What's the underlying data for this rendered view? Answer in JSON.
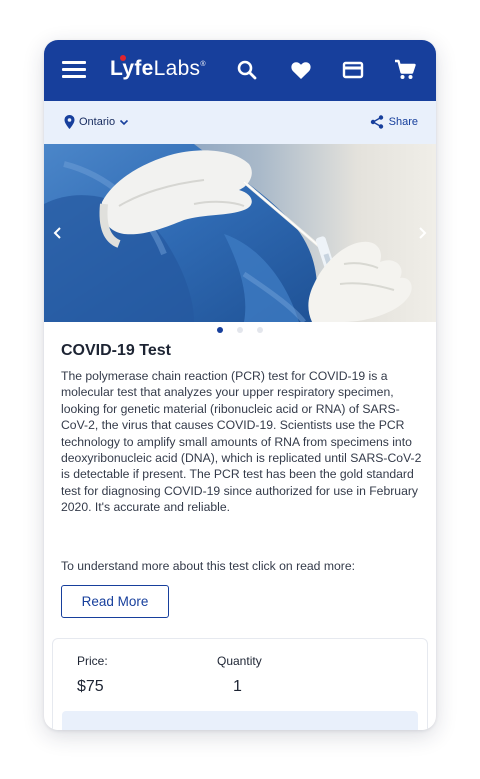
{
  "header": {
    "logo_main": "Lyfe",
    "logo_sub": "Labs",
    "logo_mark": "®",
    "menu_icon": "hamburger-menu-icon",
    "search_icon": "search-icon",
    "favorites_icon": "heart-icon",
    "card_icon": "credit-card-icon",
    "cart_icon": "shopping-cart-icon",
    "brand_color": "#173f9c"
  },
  "location_bar": {
    "location": "Ontario",
    "share_label": "Share"
  },
  "carousel": {
    "slide_count": 3,
    "active_index": 0,
    "image_description_icon": "covid-swab-photo"
  },
  "product": {
    "title": "COVID-19 Test",
    "description": "The polymerase chain reaction (PCR) test for COVID-19 is a molecular test that analyzes your upper respiratory specimen, looking for genetic material (ribonucleic acid or RNA) of SARS-CoV-2, the virus that causes COVID-19. Scientists use the PCR technology to amplify small amounts of RNA from specimens into deoxyribonucleic acid (DNA), which is replicated until SARS-CoV-2 is detectable if present. The PCR test has been the gold standard test for diagnosing COVID-19 since authorized for use in February 2020. It's accurate and reliable.",
    "more_prompt": "To understand more about this test click on read more:",
    "read_more_label": "Read More"
  },
  "purchase": {
    "price_label": "Price:",
    "price": "$75",
    "quantity_label": "Quantity",
    "quantity": "1"
  }
}
